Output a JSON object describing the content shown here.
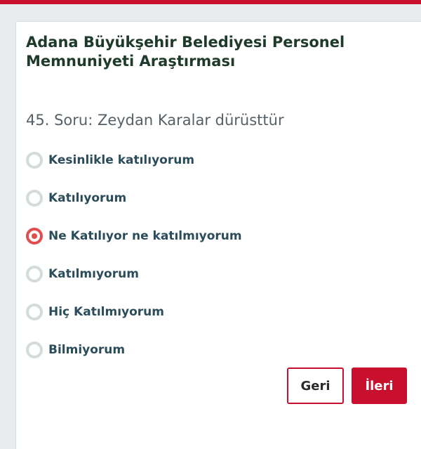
{
  "survey": {
    "title": "Adana Büyükşehir Belediyesi Personel Memnuniyeti Araştırması",
    "question": "45. Soru: Zeydan Karalar dürüsttür",
    "options": [
      {
        "label": "Kesinlikle katılıyorum",
        "selected": false
      },
      {
        "label": "Katılıyorum",
        "selected": false
      },
      {
        "label": "Ne Katılıyor ne katılmıyorum",
        "selected": true
      },
      {
        "label": "Katılmıyorum",
        "selected": false
      },
      {
        "label": "Hiç Katılmıyorum",
        "selected": false
      },
      {
        "label": "Bilmiyorum",
        "selected": false
      }
    ]
  },
  "buttons": {
    "back_label": "Geri",
    "next_label": "İleri"
  },
  "colors": {
    "accent": "#c8102e",
    "radio_selected": "#e24e4e",
    "radio_unselected": "#d3dcd8",
    "title": "#1e3a2b",
    "option_text": "#2b4c5a"
  }
}
